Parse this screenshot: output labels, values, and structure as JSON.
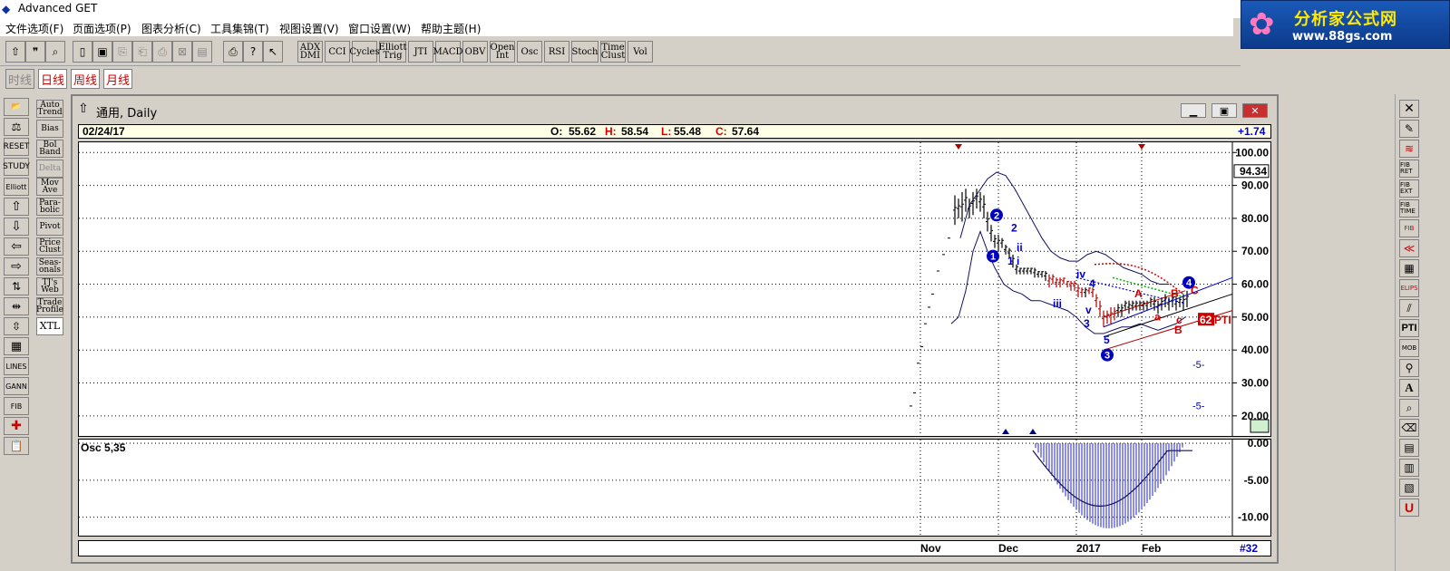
{
  "app": {
    "title": "Advanced GET"
  },
  "menu": [
    "文件选项(F)",
    "页面选项(P)",
    "图表分析(C)",
    "工具集锦(T)",
    "视图设置(V)",
    "窗口设置(W)",
    "帮助主题(H)"
  ],
  "logo": {
    "line1": "分析家公式网",
    "line2": "www.88gs.com"
  },
  "toolbar": {
    "studies": [
      "ADX DMI",
      "CCI",
      "Cycles",
      "Elliott Trig",
      "JTI",
      "MACD",
      "OBV",
      "Open Int",
      "Osc",
      "RSI",
      "Stoch",
      "Time Clust",
      "Vol"
    ]
  },
  "periods": [
    "时线",
    "日线",
    "周线",
    "月线"
  ],
  "left_studies": [
    "Auto Trend",
    "Bias",
    "Bol Band",
    "Delta",
    "Mov Ave",
    "Para-bolic",
    "Pivot",
    "Price Clust",
    "Seas-onals",
    "TJ's Web",
    "Trade Profile",
    "XTL"
  ],
  "left_tools": [
    "RESET",
    "STUDY",
    "Elliott",
    "LINES",
    "GANN",
    "FIB"
  ],
  "right_tools": [
    "FIB RET",
    "FIB EXT",
    "FIB TIME",
    "FIB",
    "ELIPS",
    "PTI",
    "MOB",
    "A"
  ],
  "window": {
    "title": "通用, Daily"
  },
  "info": {
    "date": "02/24/17",
    "o_label": "O:",
    "o": "55.62",
    "h_label": "H:",
    "h": "58.54",
    "l_label": "L:",
    "l": "55.48",
    "c_label": "C:",
    "c": "57.64",
    "change": "+1.74"
  },
  "chart_data": {
    "type": "line",
    "y_ticks": [
      "100.00",
      "90.00",
      "80.00",
      "70.00",
      "60.00",
      "50.00",
      "40.00",
      "30.00",
      "20.00"
    ],
    "last_price": "94.34",
    "ylim": [
      15,
      102
    ],
    "osc_title": "Osc 5,35",
    "osc_ticks": [
      "0.00",
      "-5.00",
      "-10.00"
    ],
    "x_labels": [
      "Nov",
      "Dec",
      "2017",
      "Feb"
    ],
    "bar_count": "#32",
    "labels": {
      "pti": "62",
      "pti_text": "PTI",
      "wave5a": "-5-",
      "wave5b": "-5-"
    },
    "wave_points": {
      "w1": "1",
      "w2": "2",
      "w3": "3",
      "w4": "4"
    },
    "wave_labels": [
      "2",
      "ii",
      "1",
      "i",
      "iii",
      "iv",
      "4",
      "v",
      "3",
      "5",
      "A",
      "a",
      "B",
      "c",
      "B",
      "C"
    ]
  }
}
